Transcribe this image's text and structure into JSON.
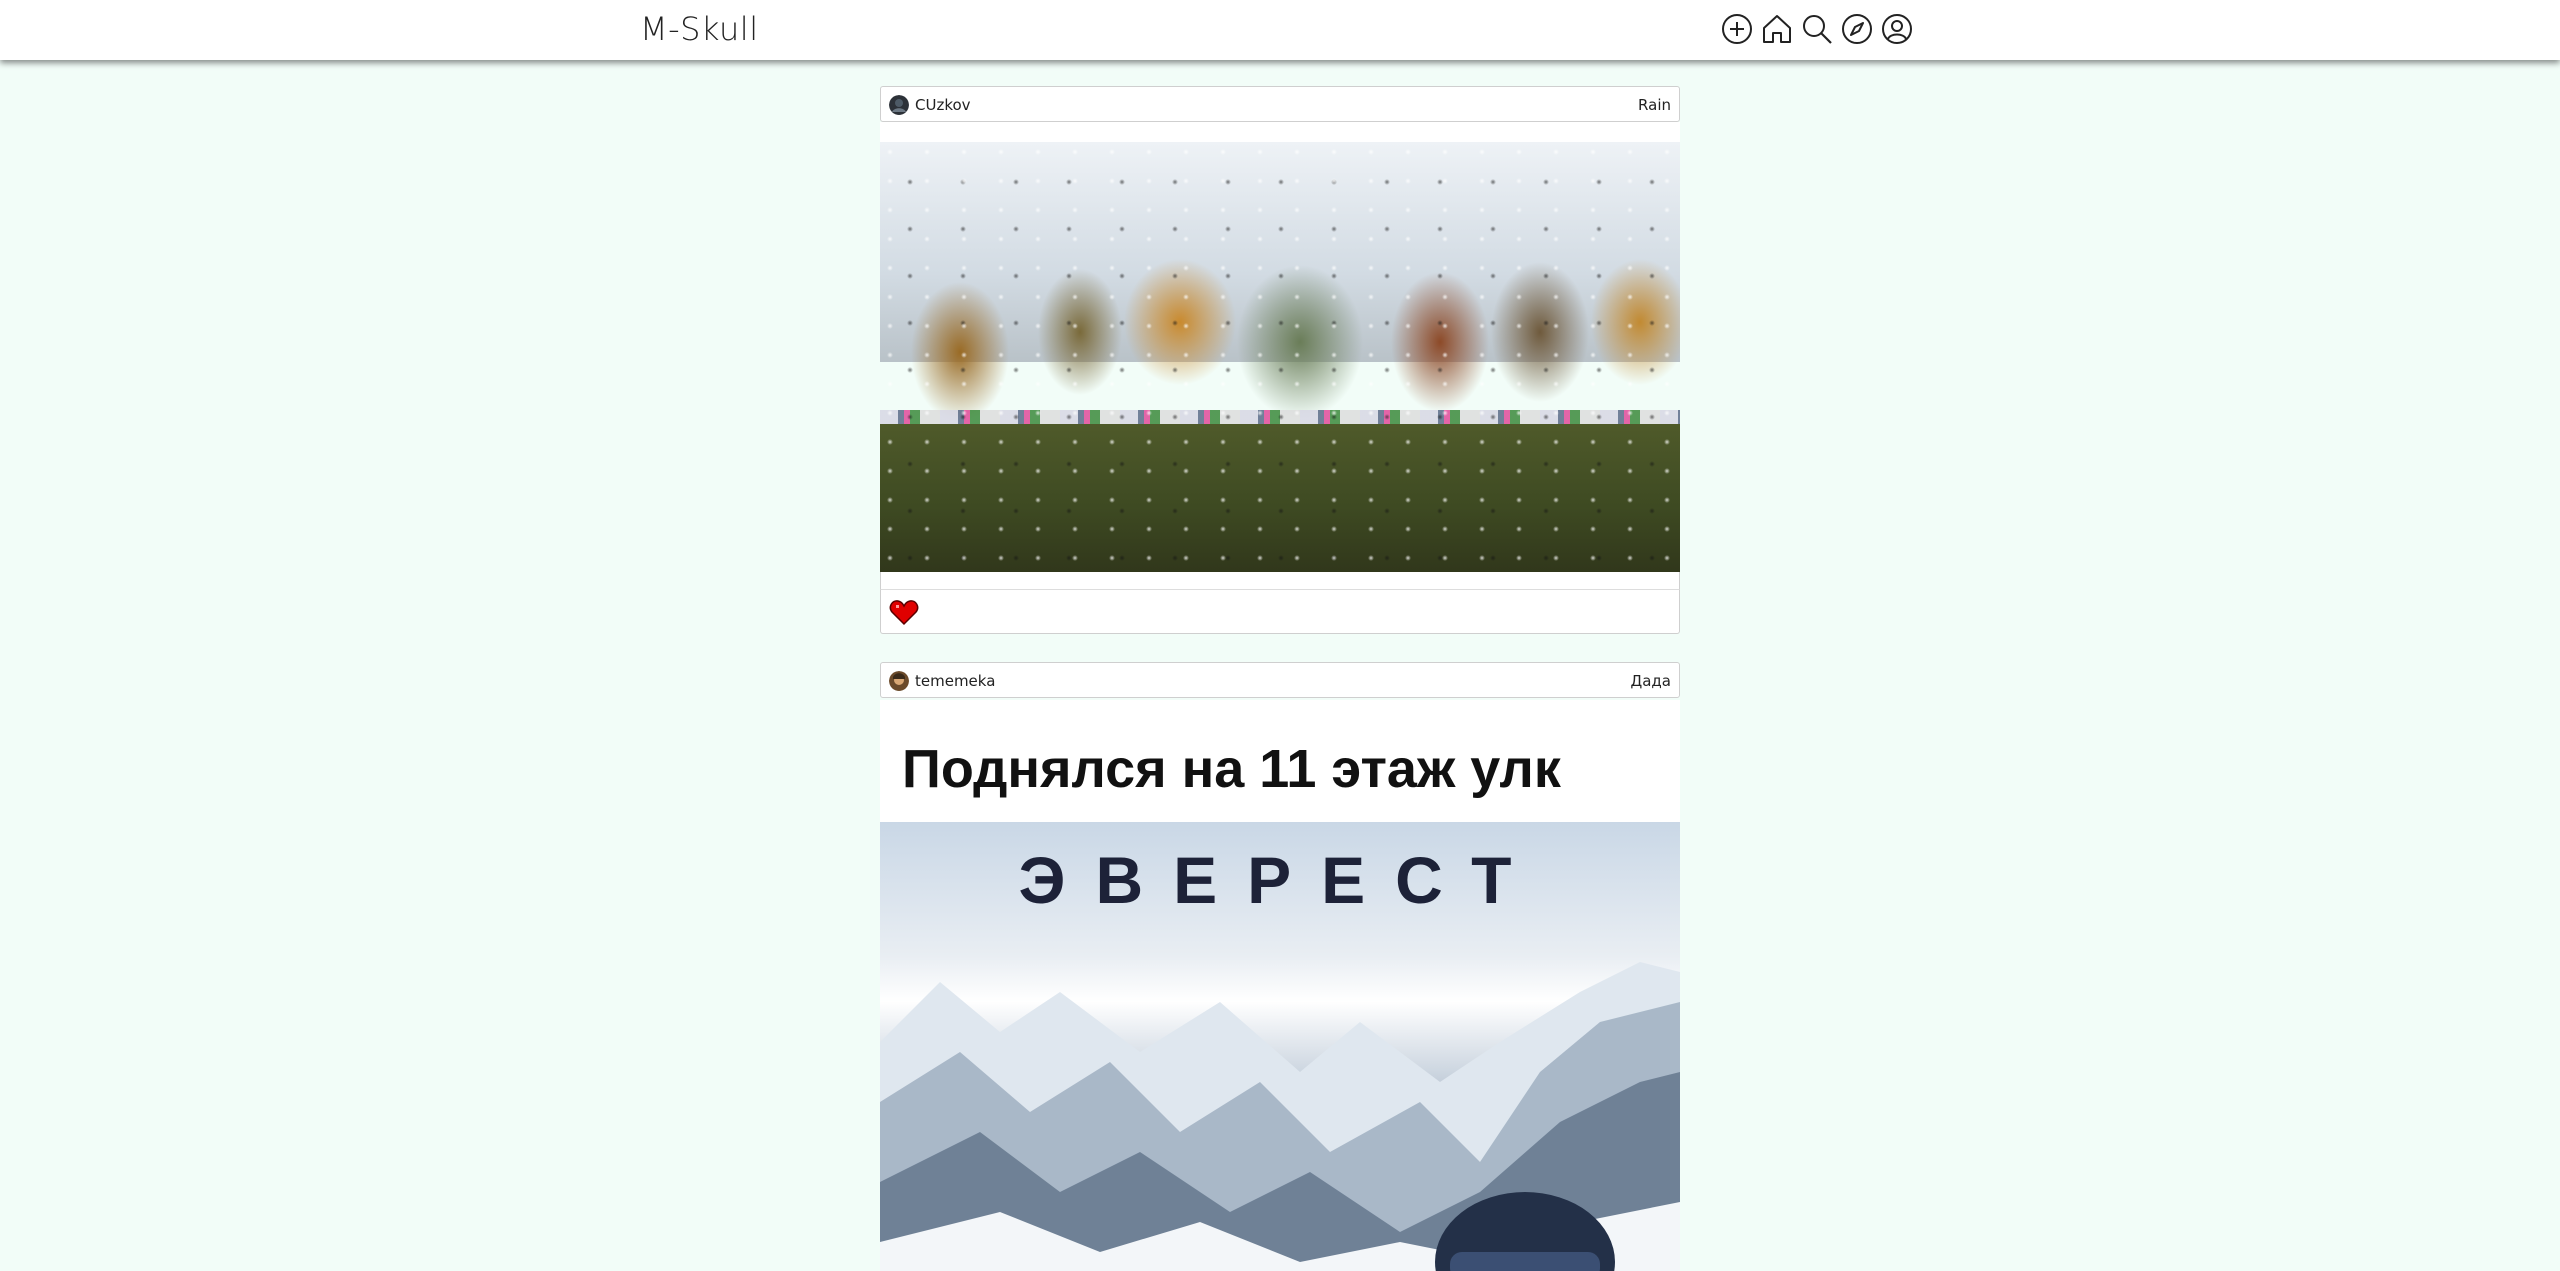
{
  "header": {
    "logo": "M-Skull",
    "icons": [
      "add-icon",
      "home-icon",
      "search-icon",
      "explore-icon",
      "profile-icon"
    ]
  },
  "posts": [
    {
      "username": "CUzkov",
      "title": "Rain",
      "image": "rainy-window-autumn-trees",
      "liked": true
    },
    {
      "username": "tememeka",
      "title": "Дада",
      "caption": "Поднялся на 11 этаж улк",
      "image_title": "ЭВЕРЕСТ"
    }
  ],
  "colors": {
    "background": "#f2fdf8",
    "like": "#e00000"
  }
}
